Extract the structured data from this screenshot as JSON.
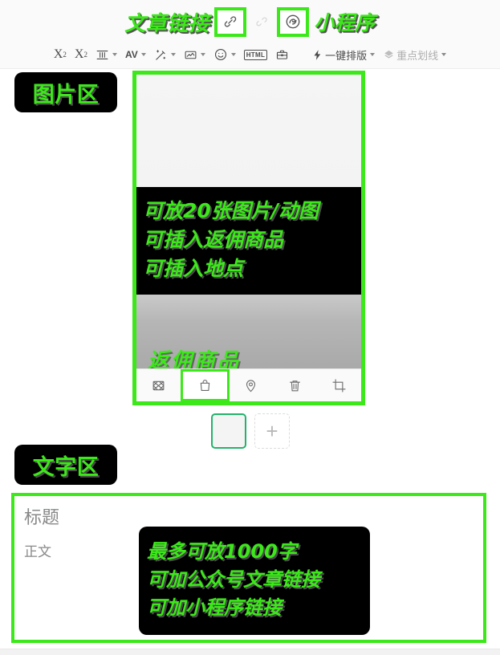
{
  "annotations": {
    "article_link": "文章链接",
    "mini_program": "小程序",
    "image_area": "图片区",
    "text_area": "文字区",
    "image_overlay_lines": [
      "可放20张图片/动图",
      "可插入返佣商品",
      "可插入地点"
    ],
    "rebate_product": "返佣商品",
    "text_overlay_lines": [
      "最多可放1000字",
      "可加公众号文章链接",
      "可加小程序链接"
    ],
    "highlight_color": "#3ce81a",
    "pill_bg": "#000000"
  },
  "link_row": {
    "link_icon": "link-icon",
    "unlink_icon": "unlink-icon",
    "miniprogram_icon": "miniprogram-icon"
  },
  "format_toolbar": {
    "superscript_label": "X",
    "superscript_exp": "2",
    "subscript_label": "X",
    "subscript_exp": "2",
    "align_icon": "text-align-icon",
    "letter_spacing_label": "AV",
    "format_brush_icon": "format-brush-icon",
    "image_icon": "insert-image-icon",
    "emoji_icon": "emoji-icon",
    "html_label": "HTML",
    "toolbox_icon": "toolbox-icon",
    "one_click_layout": "一键排版",
    "one_click_icon": "lightning-icon",
    "highlight_underline": "重点划线",
    "highlight_icon": "highlighter-icon"
  },
  "image_panel": {
    "toolbar": [
      {
        "name": "mosaic-icon",
        "selected": false
      },
      {
        "name": "shopping-bag-icon",
        "selected": true
      },
      {
        "name": "location-pin-icon",
        "selected": false
      },
      {
        "name": "trash-icon",
        "selected": false
      },
      {
        "name": "crop-icon",
        "selected": false
      }
    ]
  },
  "thumbnails": {
    "selected_thumb": "image-thumbnail",
    "add_label": "+"
  },
  "text_panel": {
    "title_placeholder": "标题",
    "body_placeholder": "正文"
  }
}
